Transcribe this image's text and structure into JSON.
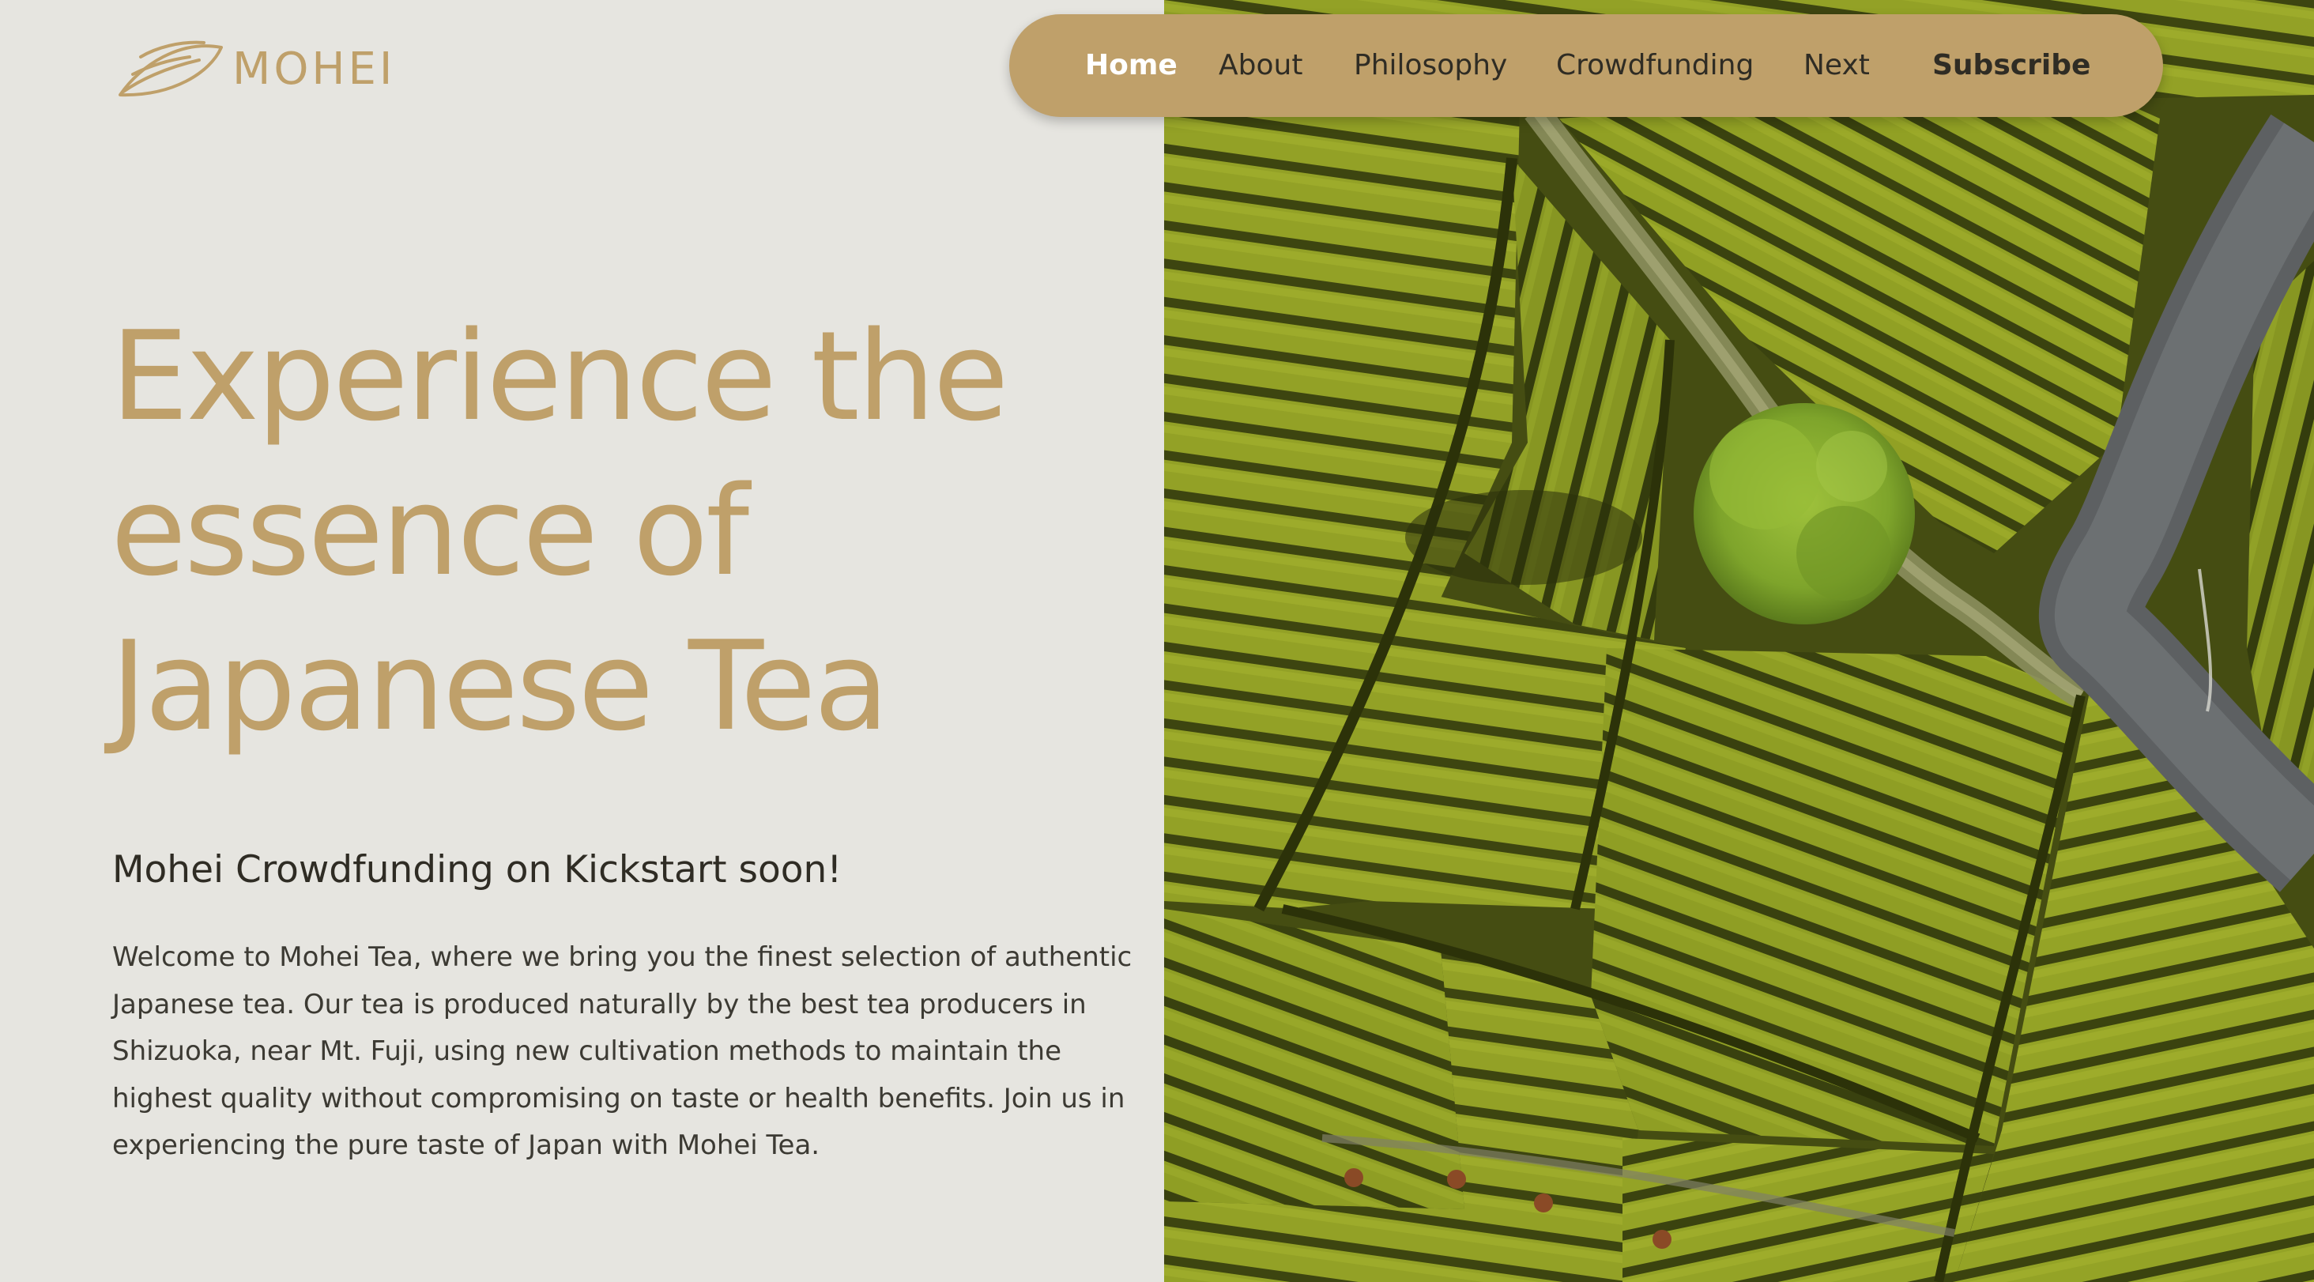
{
  "brand": {
    "name": "MOHEI",
    "logo_icon": "tea-leaf-icon",
    "color": "#bfa06a"
  },
  "nav": {
    "items": [
      {
        "label": "Home",
        "active": true
      },
      {
        "label": "About"
      },
      {
        "label": "Philosophy"
      },
      {
        "label": "Crowdfunding"
      },
      {
        "label": "Next"
      },
      {
        "label": "Subscribe"
      }
    ],
    "background": "#bfa06a"
  },
  "hero": {
    "headline_lines": [
      "Experience the",
      "essence of",
      "Japanese Tea"
    ],
    "subheading": "Mohei Crowdfunding on Kickstart soon!",
    "intro_lines": [
      "Welcome to Mohei Tea, where we bring you the finest selection of authentic",
      "Japanese tea. Our tea is produced naturally by the best tea producers in",
      "Shizuoka, near Mt. Fuji, using new cultivation methods to maintain the",
      "highest quality without compromising on taste or health benefits. Join us in",
      "experiencing the pure taste of Japan with Mohei Tea."
    ],
    "image": "aerial-tea-plantation-photo"
  },
  "colors": {
    "background": "#e6e5e0",
    "accent": "#bfa06a",
    "text": "#2f2c24"
  }
}
